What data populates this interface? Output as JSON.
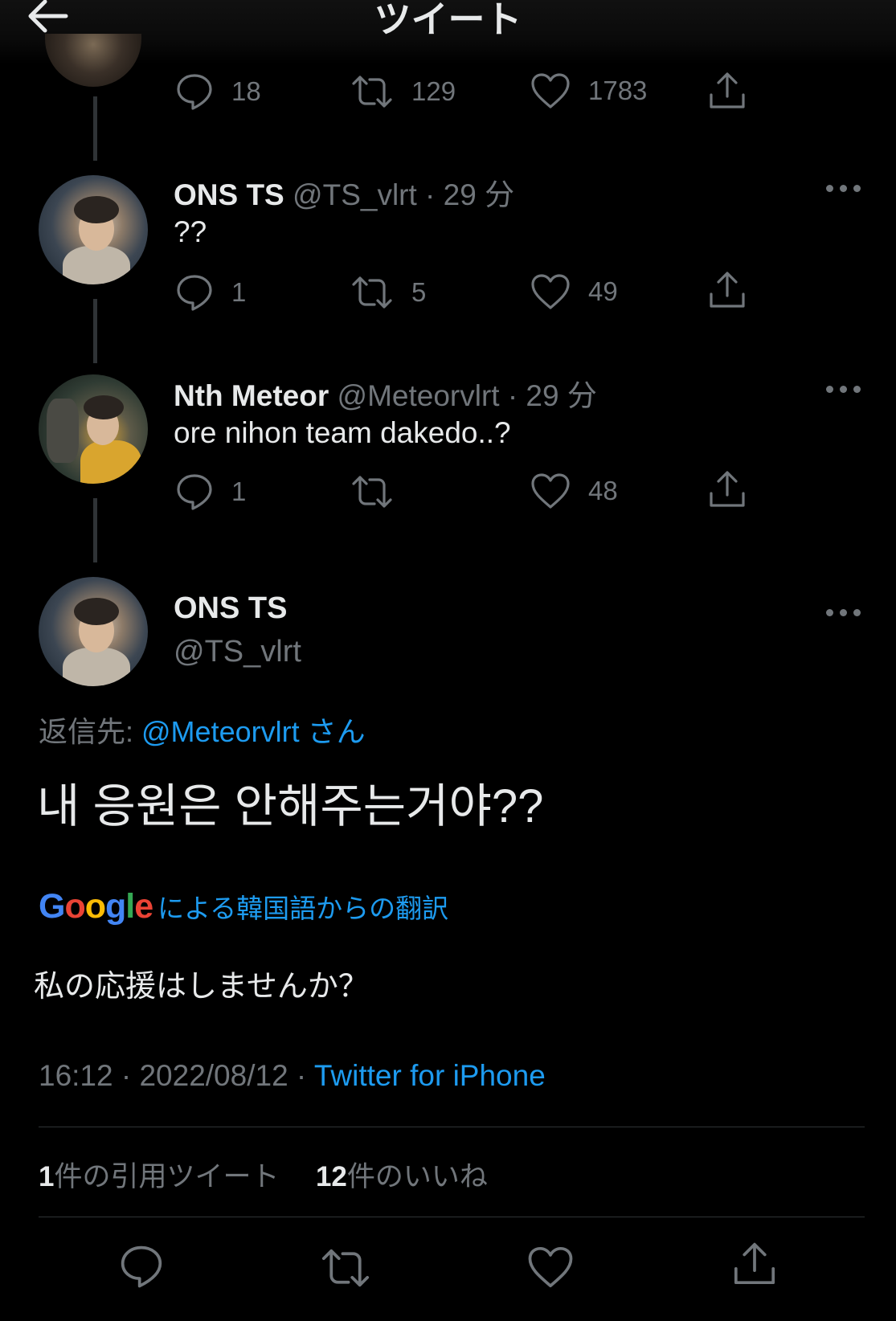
{
  "header": {
    "title": "ツイート"
  },
  "previous_tweet": {
    "reply_count": "18",
    "retweet_count": "129",
    "like_count": "1783"
  },
  "tweets": [
    {
      "name": "ONS TS",
      "handle": "@TS_vlrt · 29 分",
      "text": "??",
      "reply_count": "1",
      "retweet_count": "5",
      "like_count": "49"
    },
    {
      "name": "Nth Meteor",
      "handle": "@Meteorvlrt · 29 分",
      "text": "ore nihon team dakedo..?",
      "reply_count": "1",
      "retweet_count": "",
      "like_count": "48"
    }
  ],
  "main_tweet": {
    "name": "ONS TS",
    "handle": "@TS_vlrt",
    "reply_prefix": "返信先: ",
    "reply_target": "@Meteorvlrt さん",
    "text": "내 응원은 안해주는거야??",
    "google_letters": [
      "G",
      "o",
      "o",
      "g",
      "l",
      "e"
    ],
    "google_colors": [
      "#4285f4",
      "#ea4335",
      "#fbbc05",
      "#4285f4",
      "#34a853",
      "#ea4335"
    ],
    "translate_label": "による韓国語からの翻訳",
    "translated_text": "私の応援はしませんか？",
    "timestamp": "16:12 · 2022/08/12 · ",
    "source": "Twitter for iPhone",
    "quote_count": "1",
    "quote_label": "件の引用ツイート",
    "like_count": "12",
    "like_label": "件のいいね"
  },
  "icons": {
    "back": "arrow-left-icon",
    "reply": "speech-bubble-icon",
    "retweet": "retweet-arrows-icon",
    "like": "heart-icon",
    "share": "share-upload-icon",
    "more": "three-dots-icon"
  },
  "colors": {
    "background": "#000000",
    "text_primary": "#e7e9ea",
    "text_secondary": "#71767b",
    "link": "#1d9bf0",
    "divider": "#2f3336"
  }
}
